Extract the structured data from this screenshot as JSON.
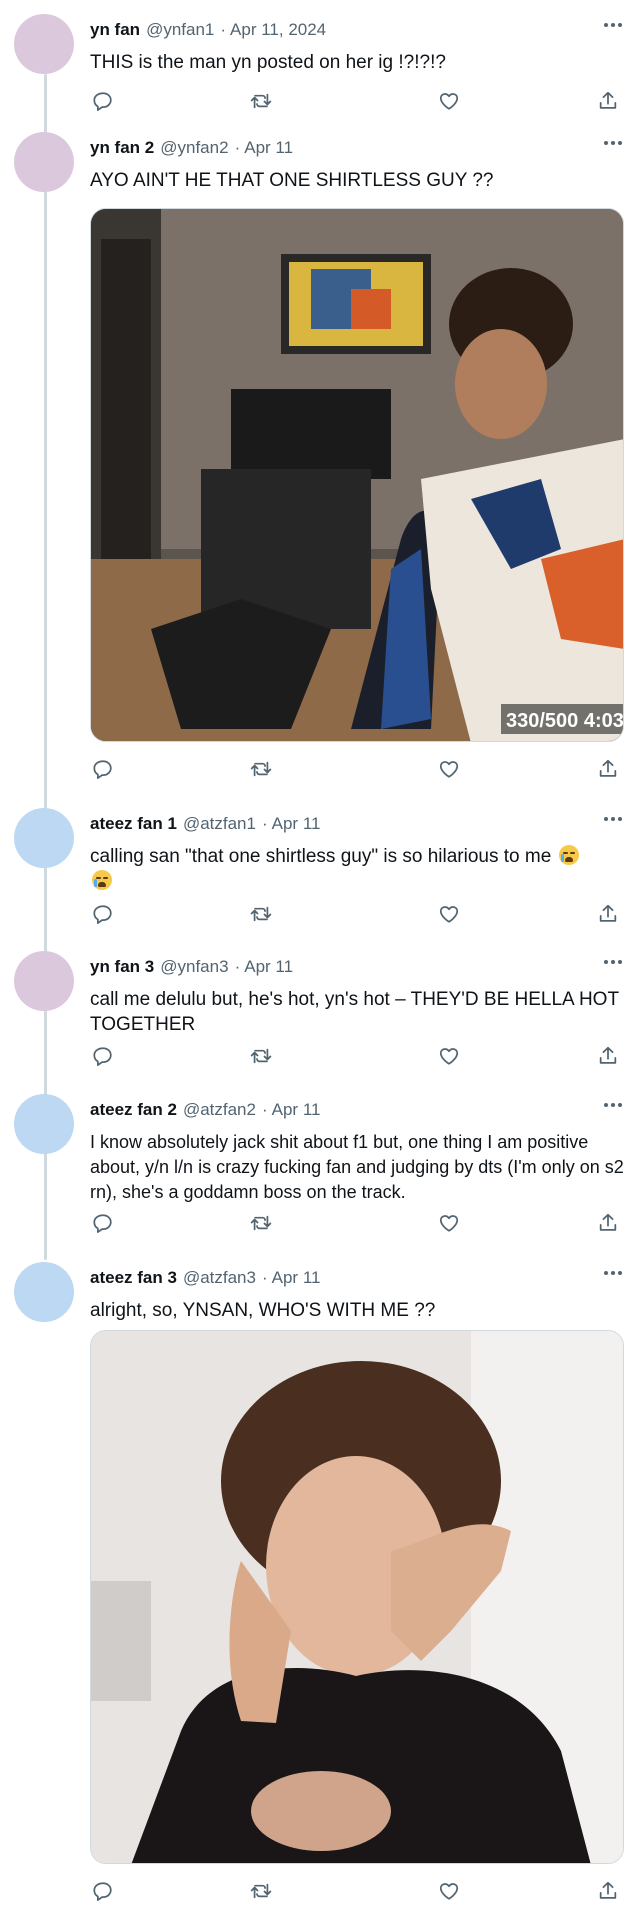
{
  "tweets": [
    {
      "name": "yn fan",
      "handle": "@ynfan1",
      "date": "Apr 11, 2024",
      "text": "THIS is the man yn posted on her ig !?!?!?",
      "avatar_color": "#dcc8dd"
    },
    {
      "name": "yn fan 2",
      "handle": "@ynfan2",
      "date": "Apr 11",
      "text": "AYO AIN'T HE THAT ONE SHIRTLESS GUY ??",
      "avatar_color": "#dcc8dd",
      "media": {
        "overlay_text": "330/500 4:03"
      }
    },
    {
      "name": "ateez fan 1",
      "handle": "@atzfan1",
      "date": "Apr 11",
      "text": "calling san \"that one shirtless guy\" is so hilarious to me",
      "emoji": "loudly-crying-face",
      "avatar_color": "#bcd8f2"
    },
    {
      "name": "yn fan 3",
      "handle": "@ynfan3",
      "date": "Apr 11",
      "text": "call me delulu but, he's hot, yn's hot – THEY'D BE HELLA HOT TOGETHER",
      "avatar_color": "#dcc8dd"
    },
    {
      "name": "ateez fan 2",
      "handle": "@atzfan2",
      "date": "Apr 11",
      "text": "I know absolutely jack shit about f1 but, one thing I am positive about, y/n l/n is crazy fucking fan and judging by dts (I'm only on s2 rn), she's a goddamn boss on the track.",
      "avatar_color": "#bcd8f2"
    },
    {
      "name": "ateez fan 3",
      "handle": "@atzfan3",
      "date": "Apr 11",
      "text": "alright, so, YNSAN, WHO'S WITH ME ??",
      "avatar_color": "#bcd8f2",
      "media": {
        "overlay_text": ""
      }
    }
  ],
  "icons": [
    "reply-icon",
    "retweet-icon",
    "like-icon",
    "share-icon",
    "more-icon"
  ],
  "colors": {
    "secondary_text": "#536471",
    "thread_line": "#cfd9de",
    "primary_text": "#0f1419"
  },
  "labels": {
    "dot": "·"
  }
}
